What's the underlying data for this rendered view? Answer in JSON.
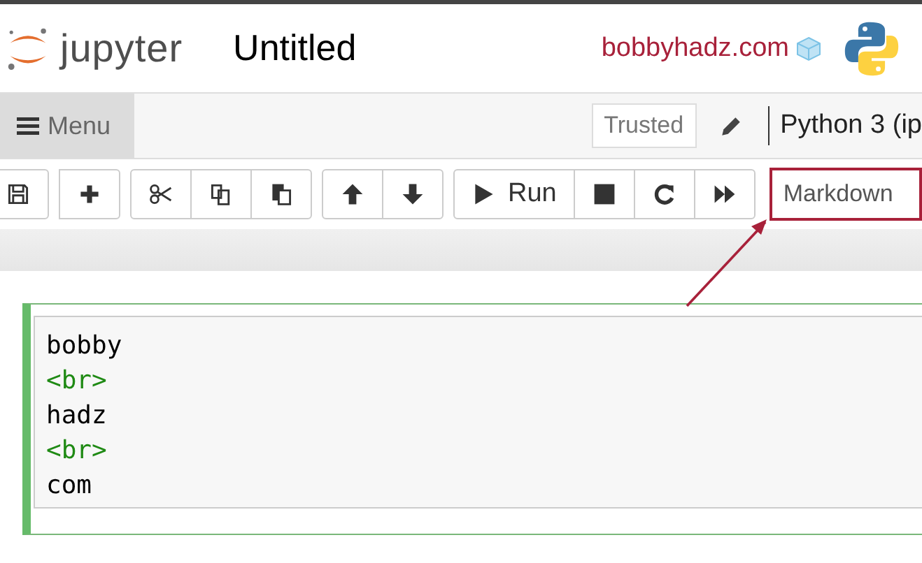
{
  "header": {
    "logo_text": "jupyter",
    "notebook_title": "Untitled",
    "site_label": "bobbyhadz.com"
  },
  "menubar": {
    "menu_button": "Menu",
    "trusted": "Trusted",
    "kernel": "Python 3 (ip"
  },
  "toolbar": {
    "groups": [
      [
        {
          "kind": "save"
        }
      ],
      [
        {
          "kind": "plus"
        }
      ],
      [
        {
          "kind": "scissors"
        },
        {
          "kind": "copy"
        },
        {
          "kind": "paste"
        }
      ],
      [
        {
          "kind": "up"
        },
        {
          "kind": "down"
        }
      ],
      [
        {
          "kind": "run",
          "label": "Run"
        },
        {
          "kind": "stop"
        },
        {
          "kind": "restart"
        },
        {
          "kind": "forward"
        }
      ]
    ],
    "cell_type": {
      "value": "Markdown",
      "highlighted": true
    }
  },
  "cell": {
    "lines": [
      {
        "text": "bobby",
        "kind": "text"
      },
      {
        "text": "<br>",
        "kind": "tag"
      },
      {
        "text": "hadz",
        "kind": "text"
      },
      {
        "text": "<br>",
        "kind": "tag"
      },
      {
        "text": "com",
        "kind": "text"
      }
    ]
  }
}
